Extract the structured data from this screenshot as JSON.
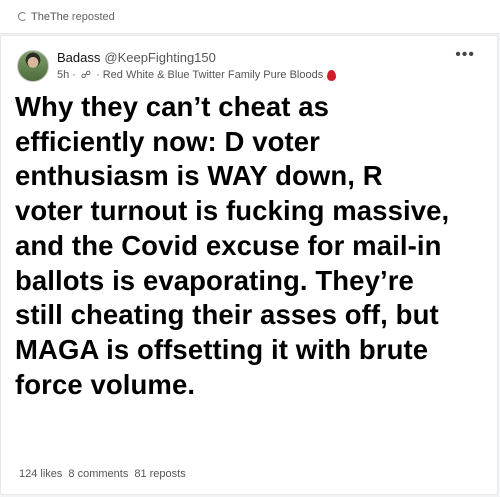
{
  "repost_header": {
    "icon": "repost-icon",
    "name_a": "TheThe",
    "name_b": "",
    "label": "reposted"
  },
  "post": {
    "author": {
      "display_name": "Badass",
      "handle": "@KeepFighting150"
    },
    "meta": {
      "time": "5h",
      "dot": "·",
      "visibility_icon": "globe-icon",
      "community": "Red White & Blue Twitter Family Pure Bloods",
      "badge_icon": "blood-drop-icon",
      "badge_color": "#d11a2a"
    },
    "more_label": "•••",
    "lines": [
      "Why they can’t cheat as",
      "efficiently now: D voter",
      "enthusiasm is WAY down, R",
      "voter turnout is fucking massive,",
      "and the Covid excuse for mail-in",
      "ballots is evaporating. They’re",
      "still cheating their asses off, but",
      "MAGA is offsetting it with brute",
      "force volume."
    ],
    "stats": {
      "likes": "124 likes",
      "comments": "8 comments",
      "reposts": "81 reposts"
    }
  }
}
